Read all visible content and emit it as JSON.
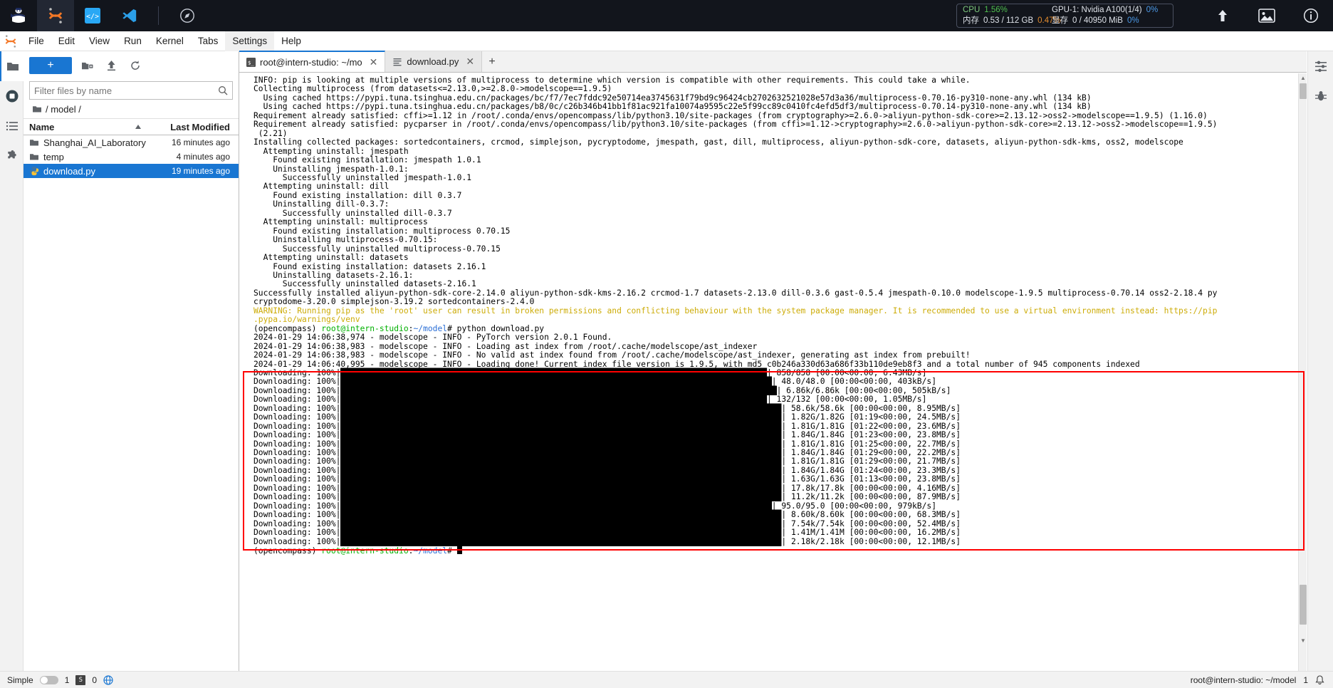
{
  "osbar": {
    "icons": [
      {
        "name": "intern-studio-logo",
        "glyph": "logo"
      },
      {
        "name": "jupyter-icon",
        "glyph": "jupyter"
      },
      {
        "name": "code-server-icon",
        "glyph": "code"
      },
      {
        "name": "vscode-icon",
        "glyph": "vscode"
      },
      {
        "name": "compass-icon",
        "glyph": "compass"
      }
    ],
    "stats": {
      "cpu_label": "CPU",
      "cpu_value": "1.56%",
      "mem_label": "内存",
      "mem_value": "0.53 / 112 GB",
      "mem_percent": "0.47%",
      "gpu_label": "GPU-1: Nvidia A100(1/4)",
      "gpu_value": "0%",
      "vram_label": "显存",
      "vram_value": "0 / 40950 MiB",
      "vram_percent": "0%"
    },
    "right_buttons": [
      {
        "name": "upload-icon",
        "title": "upload"
      },
      {
        "name": "image-icon",
        "title": "image"
      },
      {
        "name": "info-icon",
        "title": "info"
      }
    ]
  },
  "menubar": {
    "items": [
      {
        "label": "File",
        "name": "menu-file"
      },
      {
        "label": "Edit",
        "name": "menu-edit"
      },
      {
        "label": "View",
        "name": "menu-view"
      },
      {
        "label": "Run",
        "name": "menu-run"
      },
      {
        "label": "Kernel",
        "name": "menu-kernel"
      },
      {
        "label": "Tabs",
        "name": "menu-tabs"
      },
      {
        "label": "Settings",
        "name": "menu-settings"
      },
      {
        "label": "Help",
        "name": "menu-help"
      }
    ]
  },
  "activitybar": {
    "items": [
      {
        "name": "sidebar-item-file-browser",
        "icon": "folder-icon",
        "selected": true
      },
      {
        "name": "sidebar-item-running",
        "icon": "stop-icon",
        "selected": false
      },
      {
        "name": "sidebar-item-toc",
        "icon": "list-icon",
        "selected": false
      },
      {
        "name": "sidebar-item-extensions",
        "icon": "puzzle-icon",
        "selected": false
      }
    ]
  },
  "filebrowser": {
    "new_label": "+",
    "toolbar": [
      {
        "name": "new-folder-button",
        "icon": "new-folder-icon"
      },
      {
        "name": "upload-button",
        "icon": "upload-icon"
      },
      {
        "name": "refresh-button",
        "icon": "refresh-icon"
      }
    ],
    "filter_placeholder": "Filter files by name",
    "filter_value": "",
    "breadcrumb": "/ model /",
    "columns": {
      "name": "Name",
      "modified": "Last Modified"
    },
    "rows": [
      {
        "name": "Shanghai_AI_Laboratory",
        "modified": "16 minutes ago",
        "type": "folder",
        "selected": false
      },
      {
        "name": "temp",
        "modified": "4 minutes ago",
        "type": "folder",
        "selected": false
      },
      {
        "name": "download.py",
        "modified": "19 minutes ago",
        "type": "python",
        "selected": true
      }
    ]
  },
  "tabs": [
    {
      "label": "root@intern-studio: ~/mo",
      "icon": "terminal-icon",
      "active": true,
      "closable": true
    },
    {
      "label": "download.py",
      "icon": "text-file-icon",
      "active": false,
      "closable": true
    }
  ],
  "tab_add_label": "+",
  "terminal": {
    "lines": [
      {
        "segments": [
          {
            "t": "INFO: pip is looking at multiple versions of multiprocess to determine which version is compatible with other requirements. This could take a while."
          }
        ]
      },
      {
        "segments": [
          {
            "t": "Collecting multiprocess (from datasets<=2.13.0,>=2.8.0->modelscope==1.9.5)"
          }
        ]
      },
      {
        "segments": [
          {
            "t": "  Using cached https://pypi.tuna.tsinghua.edu.cn/packages/bc/f7/7ec7fddc92e50714ea3745631f79bd9c96424cb2702632521028e57d3a36/multiprocess-0.70.16-py310-none-any.whl (134 kB)"
          }
        ]
      },
      {
        "segments": [
          {
            "t": "  Using cached https://pypi.tuna.tsinghua.edu.cn/packages/b8/0c/c26b346b41bb1f81ac921fa10074a9595c22e5f99cc89c0410fc4efd5df3/multiprocess-0.70.14-py310-none-any.whl (134 kB)"
          }
        ]
      },
      {
        "segments": [
          {
            "t": "Requirement already satisfied: cffi>=1.12 in /root/.conda/envs/opencompass/lib/python3.10/site-packages (from cryptography>=2.6.0->aliyun-python-sdk-core>=2.13.12->oss2->modelscope==1.9.5) (1.16.0)"
          }
        ]
      },
      {
        "segments": [
          {
            "t": "Requirement already satisfied: pycparser in /root/.conda/envs/opencompass/lib/python3.10/site-packages (from cffi>=1.12->cryptography>=2.6.0->aliyun-python-sdk-core>=2.13.12->oss2->modelscope==1.9.5)"
          }
        ]
      },
      {
        "segments": [
          {
            "t": " (2.21)"
          }
        ]
      },
      {
        "segments": [
          {
            "t": "Installing collected packages: sortedcontainers, crcmod, simplejson, pycryptodome, jmespath, gast, dill, multiprocess, aliyun-python-sdk-core, datasets, aliyun-python-sdk-kms, oss2, modelscope"
          }
        ]
      },
      {
        "segments": [
          {
            "t": "  Attempting uninstall: jmespath"
          }
        ]
      },
      {
        "segments": [
          {
            "t": "    Found existing installation: jmespath 1.0.1"
          }
        ]
      },
      {
        "segments": [
          {
            "t": "    Uninstalling jmespath-1.0.1:"
          }
        ]
      },
      {
        "segments": [
          {
            "t": "      Successfully uninstalled jmespath-1.0.1"
          }
        ]
      },
      {
        "segments": [
          {
            "t": "  Attempting uninstall: dill"
          }
        ]
      },
      {
        "segments": [
          {
            "t": "    Found existing installation: dill 0.3.7"
          }
        ]
      },
      {
        "segments": [
          {
            "t": "    Uninstalling dill-0.3.7:"
          }
        ]
      },
      {
        "segments": [
          {
            "t": "      Successfully uninstalled dill-0.3.7"
          }
        ]
      },
      {
        "segments": [
          {
            "t": "  Attempting uninstall: multiprocess"
          }
        ]
      },
      {
        "segments": [
          {
            "t": "    Found existing installation: multiprocess 0.70.15"
          }
        ]
      },
      {
        "segments": [
          {
            "t": "    Uninstalling multiprocess-0.70.15:"
          }
        ]
      },
      {
        "segments": [
          {
            "t": "      Successfully uninstalled multiprocess-0.70.15"
          }
        ]
      },
      {
        "segments": [
          {
            "t": "  Attempting uninstall: datasets"
          }
        ]
      },
      {
        "segments": [
          {
            "t": "    Found existing installation: datasets 2.16.1"
          }
        ]
      },
      {
        "segments": [
          {
            "t": "    Uninstalling datasets-2.16.1:"
          }
        ]
      },
      {
        "segments": [
          {
            "t": "      Successfully uninstalled datasets-2.16.1"
          }
        ]
      },
      {
        "segments": [
          {
            "t": "Successfully installed aliyun-python-sdk-core-2.14.0 aliyun-python-sdk-kms-2.16.2 crcmod-1.7 datasets-2.13.0 dill-0.3.6 gast-0.5.4 jmespath-0.10.0 modelscope-1.9.5 multiprocess-0.70.14 oss2-2.18.4 py"
          }
        ]
      },
      {
        "segments": [
          {
            "t": "cryptodome-3.20.0 simplejson-3.19.2 sortedcontainers-2.4.0"
          }
        ]
      },
      {
        "segments": [
          {
            "t": "WARNING: Running pip as the 'root' user can result in broken permissions and conflicting behaviour with the system package manager. It is recommended to use a virtual environment instead: https://pip",
            "c": "warn"
          }
        ]
      },
      {
        "segments": [
          {
            "t": ".pypa.io/warnings/venv",
            "c": "warn"
          }
        ]
      },
      {
        "segments": [
          {
            "t": "(opencompass) "
          },
          {
            "t": "root@intern-studio",
            "c": "green"
          },
          {
            "t": ":"
          },
          {
            "t": "~/model",
            "c": "blue"
          },
          {
            "t": "# python download.py"
          }
        ]
      },
      {
        "segments": [
          {
            "t": "2024-01-29 14:06:38,974 - modelscope - INFO - PyTorch version 2.0.1 Found."
          }
        ]
      },
      {
        "segments": [
          {
            "t": "2024-01-29 14:06:38,983 - modelscope - INFO - Loading ast index from /root/.cache/modelscope/ast_indexer"
          }
        ]
      },
      {
        "segments": [
          {
            "t": "2024-01-29 14:06:38,983 - modelscope - INFO - No valid ast index found from /root/.cache/modelscope/ast_indexer, generating ast index from prebuilt!"
          }
        ]
      },
      {
        "segments": [
          {
            "t": "2024-01-29 14:06:40,995 - modelscope - INFO - Loading done! Current index file version is 1.9.5, with md5 c0b246a330d63a686f33b110de9eb8f3 and a total number of 945 components indexed"
          }
        ]
      }
    ],
    "downloads": [
      {
        "label": "Downloading:",
        "percent": "100%",
        "bar_cols": 88,
        "stats": "858/858 [00:00<00:00, 6.43MB/s]"
      },
      {
        "label": "Downloading:",
        "percent": "100%",
        "bar_cols": 89,
        "stats": "48.0/48.0 [00:00<00:00, 403kB/s]"
      },
      {
        "label": "Downloading:",
        "percent": "100%",
        "bar_cols": 90,
        "stats": "6.86k/6.86k [00:00<00:00, 505kB/s]"
      },
      {
        "label": "Downloading:",
        "percent": "100%",
        "bar_cols": 88,
        "stats": "132/132 [00:00<00:00, 1.05MB/s]"
      },
      {
        "label": "Downloading:",
        "percent": "100%",
        "bar_cols": 91,
        "stats": "58.6k/58.6k [00:00<00:00, 8.95MB/s]"
      },
      {
        "label": "Downloading:",
        "percent": "100%",
        "bar_cols": 91,
        "stats": "1.82G/1.82G [01:19<00:00, 24.5MB/s]"
      },
      {
        "label": "Downloading:",
        "percent": "100%",
        "bar_cols": 91,
        "stats": "1.81G/1.81G [01:22<00:00, 23.6MB/s]"
      },
      {
        "label": "Downloading:",
        "percent": "100%",
        "bar_cols": 91,
        "stats": "1.84G/1.84G [01:23<00:00, 23.8MB/s]"
      },
      {
        "label": "Downloading:",
        "percent": "100%",
        "bar_cols": 91,
        "stats": "1.81G/1.81G [01:25<00:00, 22.7MB/s]"
      },
      {
        "label": "Downloading:",
        "percent": "100%",
        "bar_cols": 91,
        "stats": "1.84G/1.84G [01:29<00:00, 22.2MB/s]"
      },
      {
        "label": "Downloading:",
        "percent": "100%",
        "bar_cols": 91,
        "stats": "1.81G/1.81G [01:29<00:00, 21.7MB/s]"
      },
      {
        "label": "Downloading:",
        "percent": "100%",
        "bar_cols": 91,
        "stats": "1.84G/1.84G [01:24<00:00, 23.3MB/s]"
      },
      {
        "label": "Downloading:",
        "percent": "100%",
        "bar_cols": 91,
        "stats": "1.63G/1.63G [01:13<00:00, 23.8MB/s]"
      },
      {
        "label": "Downloading:",
        "percent": "100%",
        "bar_cols": 91,
        "stats": "17.8k/17.8k [00:00<00:00, 4.16MB/s]"
      },
      {
        "label": "Downloading:",
        "percent": "100%",
        "bar_cols": 91,
        "stats": "11.2k/11.2k [00:00<00:00, 87.9MB/s]"
      },
      {
        "label": "Downloading:",
        "percent": "100%",
        "bar_cols": 89,
        "stats": "95.0/95.0 [00:00<00:00, 979kB/s]"
      },
      {
        "label": "Downloading:",
        "percent": "100%",
        "bar_cols": 91,
        "stats": "8.60k/8.60k [00:00<00:00, 68.3MB/s]"
      },
      {
        "label": "Downloading:",
        "percent": "100%",
        "bar_cols": 91,
        "stats": "7.54k/7.54k [00:00<00:00, 52.4MB/s]"
      },
      {
        "label": "Downloading:",
        "percent": "100%",
        "bar_cols": 91,
        "stats": "1.41M/1.41M [00:00<00:00, 16.2MB/s]"
      },
      {
        "label": "Downloading:",
        "percent": "100%",
        "bar_cols": 91,
        "stats": "2.18k/2.18k [00:00<00:00, 12.1MB/s]"
      }
    ],
    "final_prompt": [
      {
        "t": "(opencompass) "
      },
      {
        "t": "root@intern-studio",
        "c": "green"
      },
      {
        "t": ":"
      },
      {
        "t": "~/model",
        "c": "blue"
      },
      {
        "t": "# "
      }
    ]
  },
  "rightrail": {
    "items": [
      {
        "name": "property-inspector-icon",
        "icon": "sliders-icon"
      },
      {
        "name": "debugger-icon",
        "icon": "bug-icon"
      }
    ]
  },
  "statusbar": {
    "mode_label": "Simple",
    "terminal_count": "1",
    "kernel_badge": "S",
    "kernel_count": "0",
    "globe_label": "globe-icon",
    "path": "root@intern-studio: ~/model",
    "notification_count": "1"
  },
  "colors": {
    "accent": "#1976d2",
    "redbox": "#ff0000",
    "warn": "#cdac08",
    "prompt_green": "#00b000",
    "prompt_blue": "#2b6fd6"
  }
}
